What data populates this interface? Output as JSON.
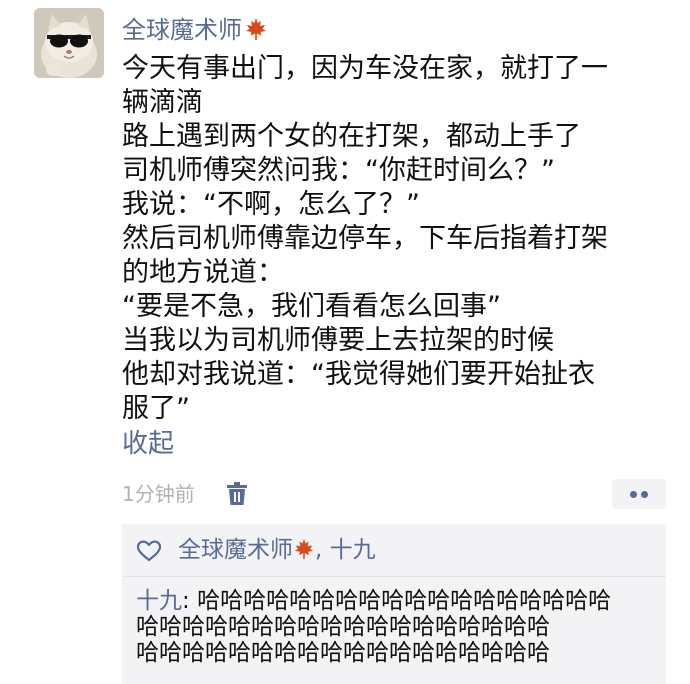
{
  "post": {
    "author_name": "全球魔术师",
    "author_badge_icon": "maple-leaf-icon",
    "content_lines": [
      "今天有事出门，因为车没在家，就打了一",
      "辆滴滴",
      "路上遇到两个女的在打架，都动上手了",
      "司机师傅突然问我：“你赶时间么？”",
      "我说：“不啊，怎么了？”",
      "然后司机师傅靠边停车，下车后指着打架",
      "的地方说道：",
      "“要是不急，我们看看怎么回事”",
      "当我以为司机师傅要上去拉架的时候",
      "他却对我说道：“我觉得她们要开始扯衣",
      "服了”"
    ],
    "collapse_label": "收起",
    "time": "1分钟前",
    "delete_icon": "trash-icon",
    "more_icon": "more-dots-icon"
  },
  "likes": {
    "icon": "heart-icon",
    "names": "全球魔术师",
    "names_rest": ", 十九"
  },
  "comments": [
    {
      "author": "十九",
      "separator": ": ",
      "lines": [
        "哈哈哈哈哈哈哈哈哈哈哈哈哈哈哈哈哈哈",
        "哈哈哈哈哈哈哈哈哈哈哈哈哈哈哈哈哈哈",
        "哈哈哈哈哈哈哈哈哈哈哈哈哈哈哈哈哈哈"
      ]
    }
  ],
  "colors": {
    "link_blue": "#576b95",
    "meta_gray": "#b2b2b2",
    "panel_bg": "#f3f3f5",
    "leaf_red": "#d84a1b"
  }
}
